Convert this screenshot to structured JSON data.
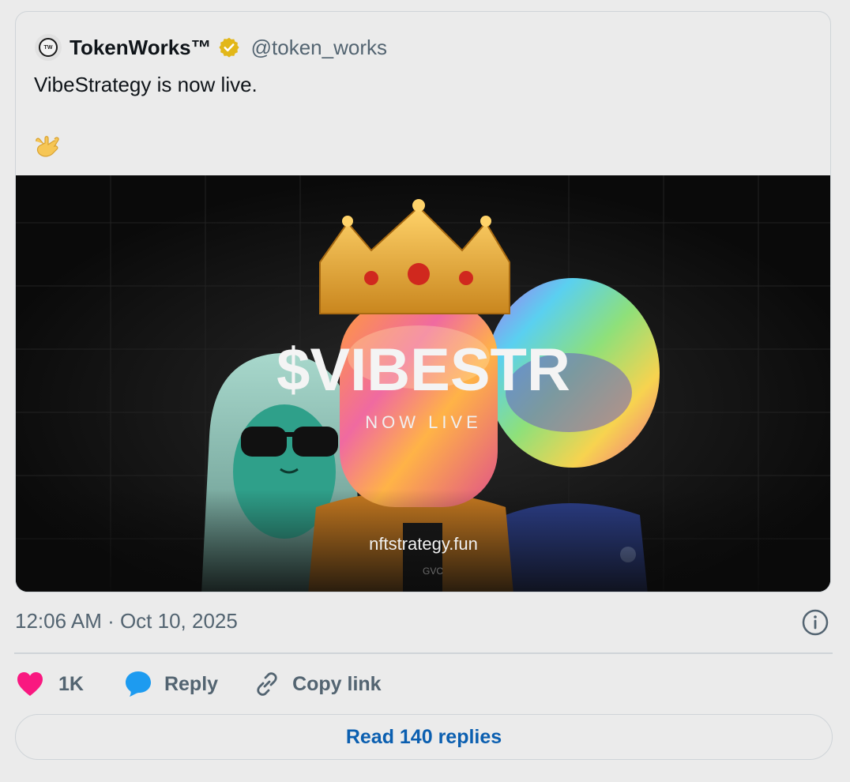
{
  "post": {
    "author_name": "TokenWorks™",
    "author_handle": "@token_works",
    "avatar_text": "TW",
    "verified": true,
    "text": "VibeStrategy is now live.",
    "emoji": "call-me-hand",
    "media": {
      "headline": "$VIBESTR",
      "subline": "NOW LIVE",
      "url_text": "nftstrategy.fun",
      "shirt_text": "GVC"
    },
    "timestamp": "12:06 AM · Oct 10, 2025"
  },
  "actions": {
    "like_count": "1K",
    "reply_label": "Reply",
    "copy_label": "Copy link"
  },
  "read_replies_label": "Read 140 replies",
  "colors": {
    "like": "#f91880",
    "reply_bubble": "#1d9bf0",
    "link_text": "#0b5fb0",
    "verified_badge": "#e2b719"
  }
}
